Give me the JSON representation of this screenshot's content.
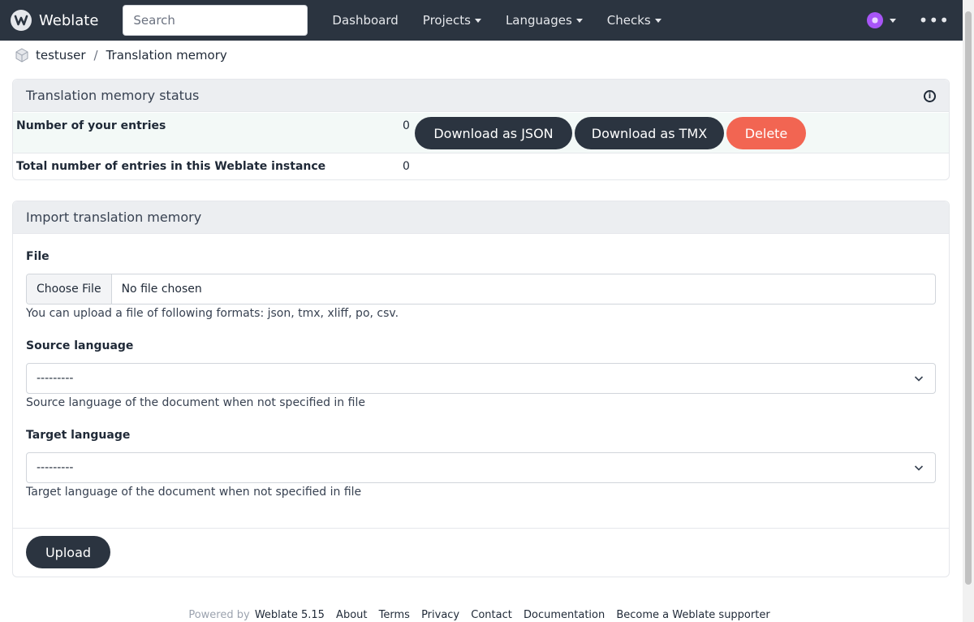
{
  "nav": {
    "brand": "Weblate",
    "search_placeholder": "Search",
    "links": [
      "Dashboard",
      "Projects",
      "Languages",
      "Checks"
    ]
  },
  "breadcrumb": {
    "user": "testuser",
    "separator": "/",
    "page": "Translation memory"
  },
  "status": {
    "title": "Translation memory status",
    "rows": [
      {
        "label": "Number of your entries",
        "value": "0"
      },
      {
        "label": "Total number of entries in this Weblate instance",
        "value": "0"
      }
    ],
    "download_json": "Download as JSON",
    "download_tmx": "Download as TMX",
    "delete": "Delete"
  },
  "import": {
    "title": "Import translation memory",
    "file_label": "File",
    "choose_file": "Choose File",
    "no_file": "No file chosen",
    "file_help": "You can upload a file of following formats: json, tmx, xliff, po, csv.",
    "source_label": "Source language",
    "source_value": "---------",
    "source_help": "Source language of the document when not specified in file",
    "target_label": "Target language",
    "target_value": "---------",
    "target_help": "Target language of the document when not specified in file",
    "upload": "Upload"
  },
  "footer": {
    "powered_by": "Powered by",
    "version": "Weblate 5.15",
    "links": [
      "About",
      "Terms",
      "Privacy",
      "Contact",
      "Documentation",
      "Become a Weblate supporter"
    ]
  },
  "colors": {
    "navbar": "#2b3440",
    "primary_button": "#2b3440",
    "danger_button": "#f26552",
    "highlight_row": "#f3f9f7"
  }
}
